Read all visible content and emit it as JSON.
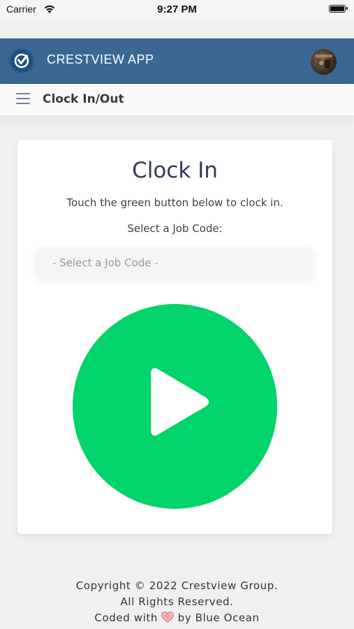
{
  "status_bar": {
    "carrier": "Carrier",
    "time": "9:27 PM"
  },
  "header": {
    "app_title": "CRESTVIEW APP",
    "brand_color": "#3a6893"
  },
  "subheader": {
    "page_title": "Clock In/Out"
  },
  "card": {
    "title": "Clock In",
    "instructions": "Touch the green button below to clock in.",
    "select_label": "Select a Job Code:",
    "job_code_placeholder": "- Select a Job Code -",
    "clock_button_color": "#00d46a",
    "clock_button_icon": "play-icon"
  },
  "footer": {
    "copyright": "Copyright © 2022 Crestview Group.",
    "rights": "All Rights Reserved.",
    "coded_with": "Coded with",
    "by": "by Blue Ocean",
    "heart_icon": "heart-icon",
    "heart_color": "#f07c8a"
  }
}
